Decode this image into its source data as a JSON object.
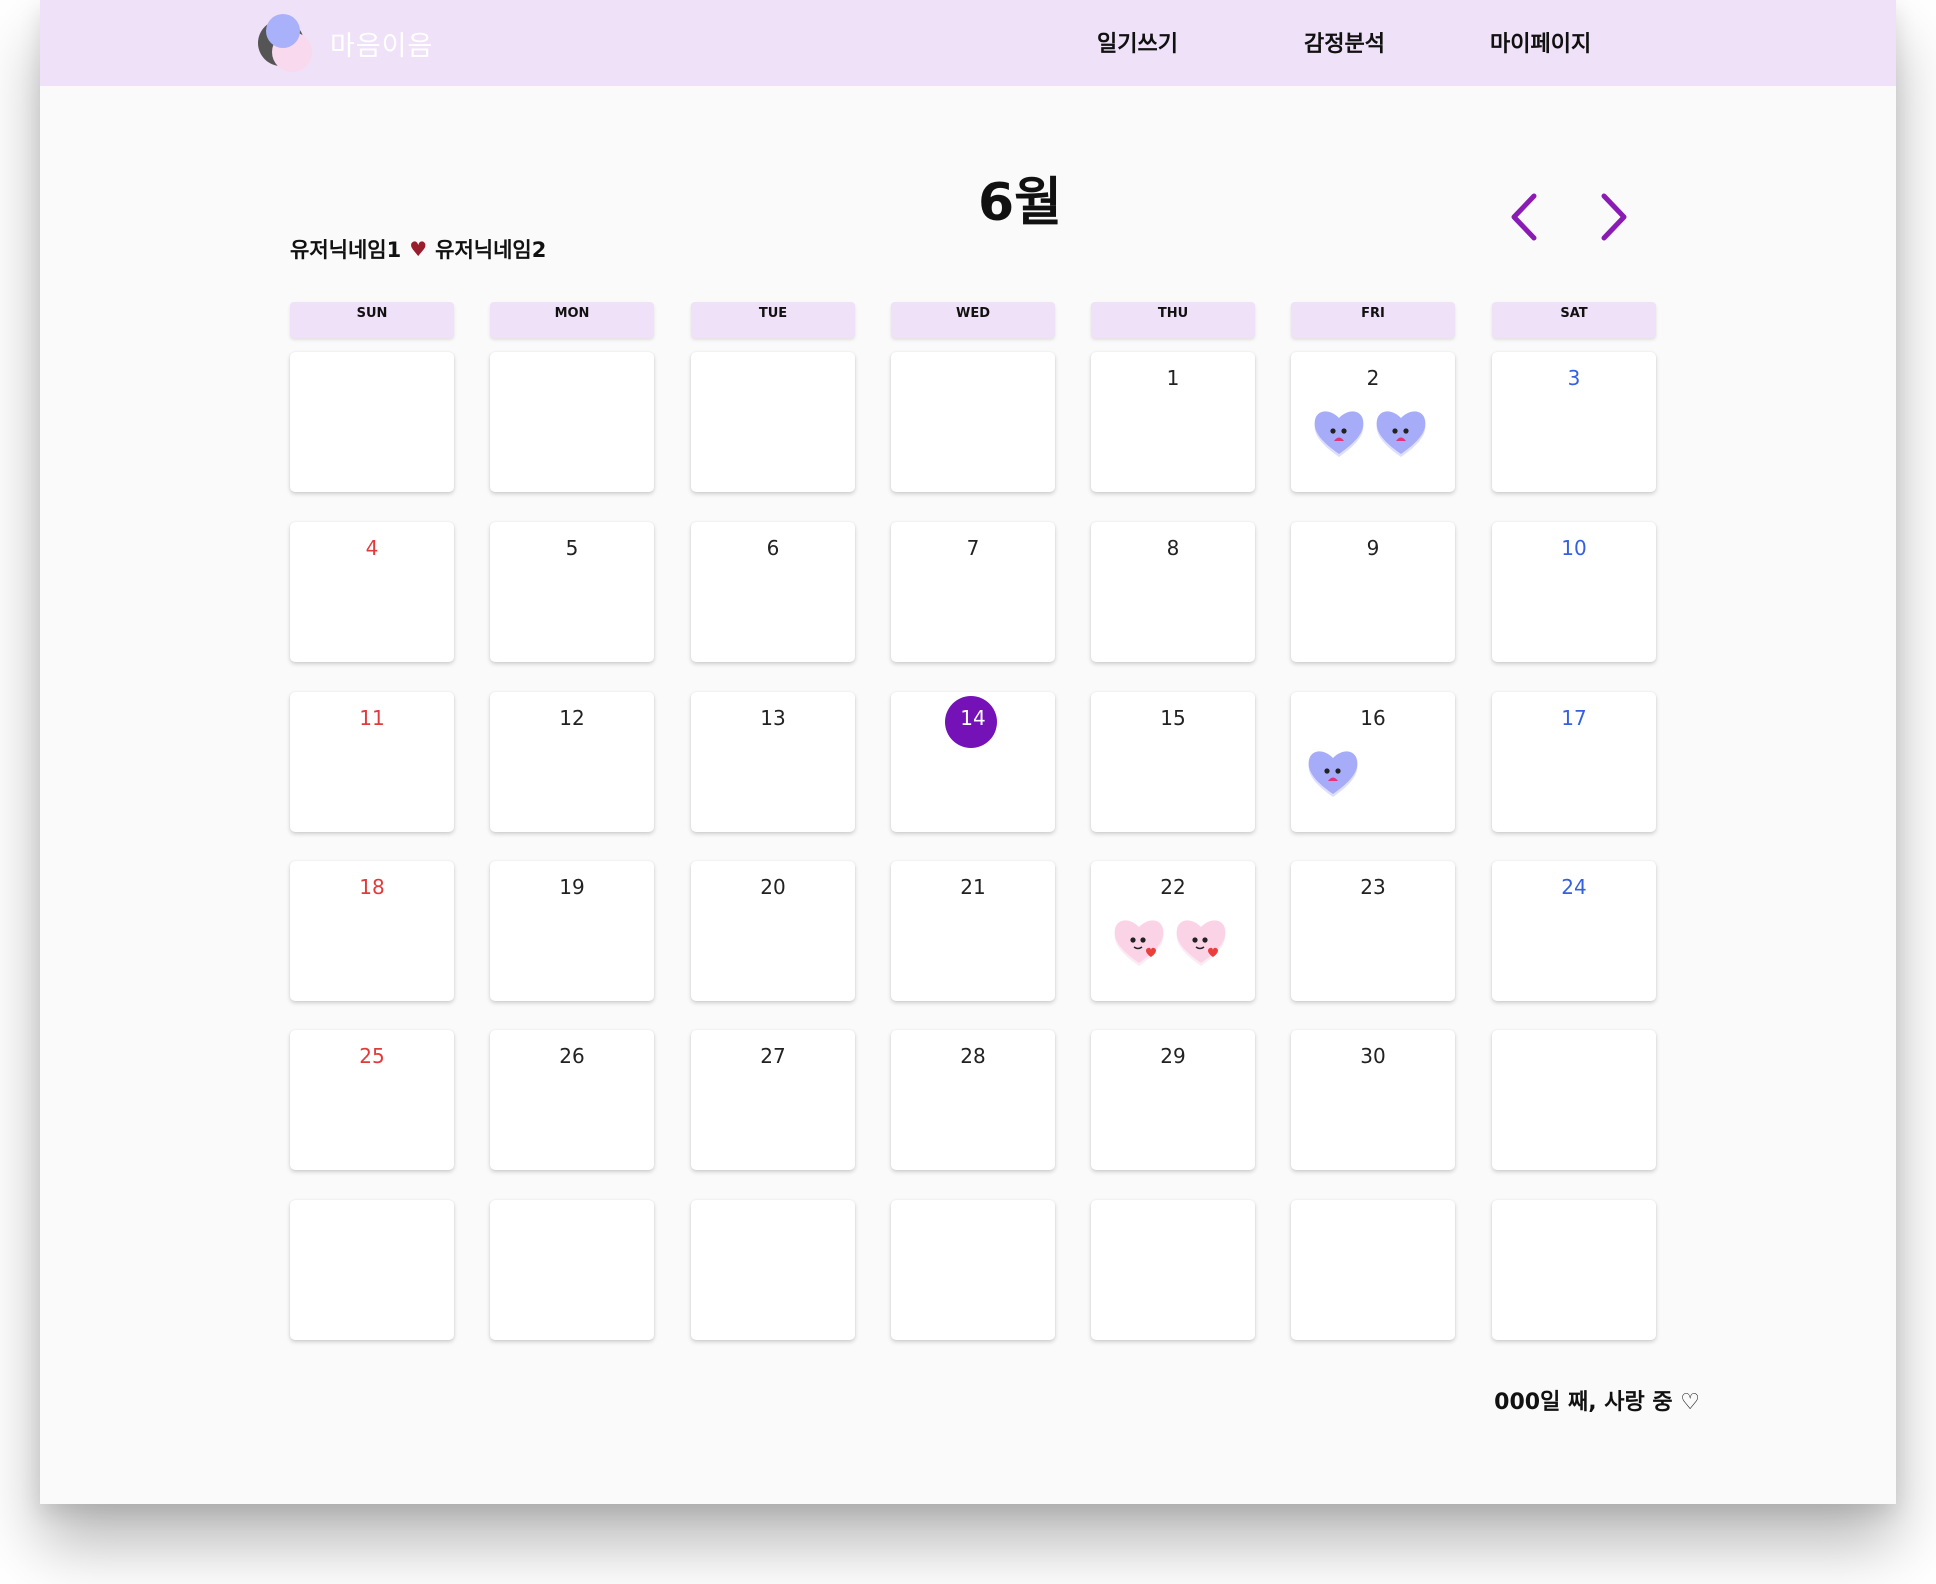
{
  "header": {
    "brand": "마음이음",
    "nav": [
      "일기쓰기",
      "감정분석",
      "마이페이지"
    ]
  },
  "calendar": {
    "month_title": "6월",
    "couple": {
      "user1": "유저닉네임1",
      "heart": "♥",
      "user2": "유저닉네임2"
    },
    "weekdays": [
      "SUN",
      "MON",
      "TUE",
      "WED",
      "THU",
      "FRI",
      "SAT"
    ],
    "days": [
      "",
      "",
      "",
      "",
      "1",
      "2",
      "3",
      "4",
      "5",
      "6",
      "7",
      "8",
      "9",
      "10",
      "11",
      "12",
      "13",
      "14",
      "15",
      "16",
      "17",
      "18",
      "19",
      "20",
      "21",
      "22",
      "23",
      "24",
      "25",
      "26",
      "27",
      "28",
      "29",
      "30",
      "",
      "",
      "",
      "",
      "",
      "",
      "",
      ""
    ],
    "today": "14",
    "emotions": {
      "2": [
        "sad-heart",
        "sad-heart"
      ],
      "16": [
        "sad-heart"
      ],
      "22": [
        "love-heart",
        "love-heart"
      ]
    }
  },
  "colors": {
    "nav_bg": "#efe1f7",
    "accent": "#7412b8",
    "sunday": "#e23a3a",
    "saturday": "#3560e0",
    "arrow": "#8a1bb5"
  },
  "footer": {
    "anniversary": "000일 째, 사랑 중 ♡"
  }
}
